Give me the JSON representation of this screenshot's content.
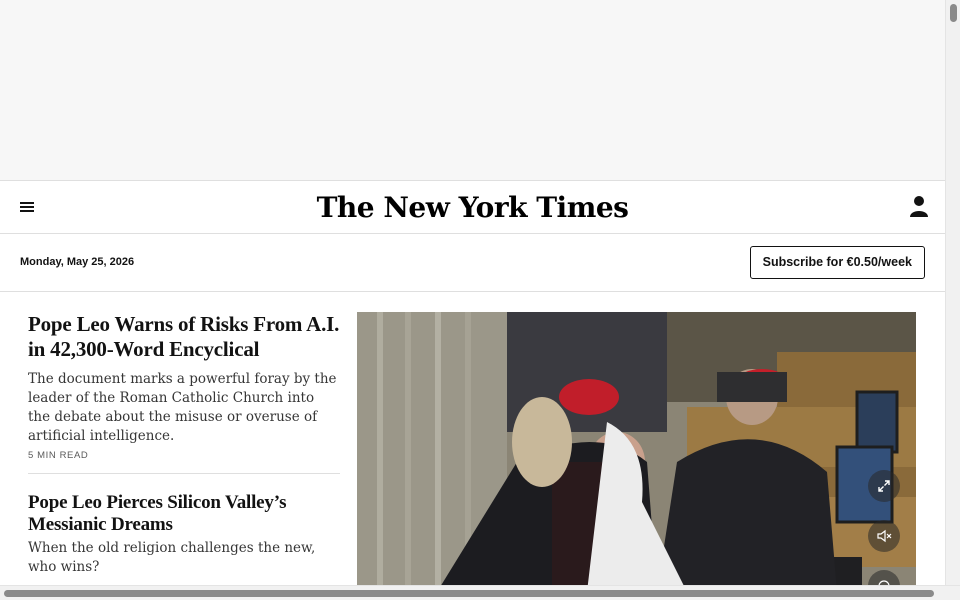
{
  "masthead": {
    "logo_text": "The New York Times",
    "menu_icon": "hamburger-menu-icon",
    "account_icon": "user-account-icon"
  },
  "dateline": {
    "date": "Monday, May 25, 2026",
    "subscribe_label": "Subscribe for €0.50/week"
  },
  "stories": [
    {
      "headline": "Pope Leo Warns of Risks From A.I. in 42,300-Word Encyclical",
      "summary": "The document marks a powerful foray by the leader of the Roman Catholic Church into the debate about the misuse or overuse of artificial intelligence.",
      "read_time": "5 MIN READ"
    },
    {
      "headline": "Pope Leo Pierces Silicon Valley’s Messianic Dreams",
      "summary": "When the old religion challenges the new, who wins?"
    }
  ],
  "video": {
    "controls": [
      "expand-icon",
      "mute-icon",
      "share-icon"
    ]
  },
  "colors": {
    "text": "#121212",
    "divider": "#dfdfdf",
    "ad_background": "#f7f7f7"
  }
}
